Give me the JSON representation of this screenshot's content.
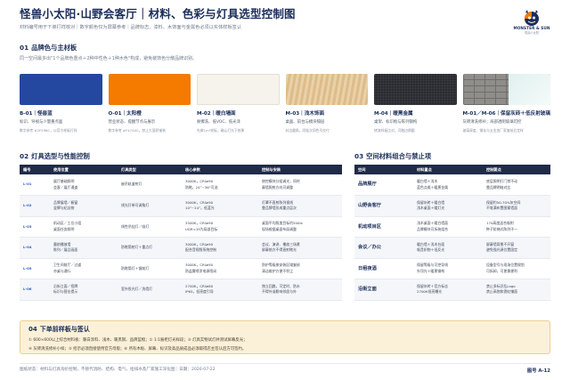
{
  "header": {
    "title": "怪兽小太阳·山野会客厅｜材料、色彩与灯具选型控制图",
    "subtitle": "材料编号用于下单打样核对｜数字颜色仅为屏幕参考｜品牌标志、漆料、木饰面与金属色必须以实体样板签认",
    "logo_text": "MONSTER & SUN",
    "logo_sub": "怪兽小太阳"
  },
  "section1": {
    "number": "01",
    "title": "品牌色与主材板",
    "desc": "同一空间最多出\"1个品牌色重点＋2种中性色＋1种木色\"构成，避免装饰色分散品牌识别。",
    "swatches": [
      {
        "name": "B-01｜怪兽蓝",
        "desc": "标识、导视与少量重点面",
        "spec": "数字参考 #2F59BC，以官方样板打样",
        "color": "#2448a0"
      },
      {
        "name": "O-01｜太阳橙",
        "desc": "营业状态、提醒节点与展示",
        "spec": "数字参考 #F47A00，禁止大面积铺装",
        "color": "#f47a00"
      },
      {
        "name": "M-02｜暖白墙面",
        "desc": "耐擦洗、低VOC、低光泽",
        "spec": "先做1m²样板，确认灯光下效果",
        "color": "#f6f3ec"
      },
      {
        "name": "M-03｜浅木饰面",
        "desc": "桌面、前台与模块隔层",
        "spec": "封边圆角，同批次同色号交付",
        "color": "#e6c796"
      },
      {
        "name": "M-04｜暖黑金属",
        "desc": "桌架、标识框与陈列钢构",
        "spec": "烤漆样板比对，可触边倒圆",
        "color": "#2a2c31"
      },
      {
        "name": "M-01／M-06｜保留灰砖＋低反射玻璃",
        "desc": "灰砖清洗修补；局部透明玻璃可控",
        "spec": "玻璃厚度、钢化与五金由厂家复核后定样",
        "color": "#8f8e8b"
      }
    ]
  },
  "section2": {
    "number": "02",
    "title": "灯具选型与性能控制",
    "headers": [
      "编号",
      "使用位置",
      "灯具类型",
      "核心参数",
      "控制与安装"
    ],
    "rows": [
      {
        "code": "L-01",
        "location": [
          "展厅基础照明",
          "会客／展厅通道"
        ],
        "type": [
          "嵌吊轨道射灯"
        ],
        "params": [
          "3000K，CRI≥90",
          "防眩，24°~36°可选"
        ],
        "control": [
          "统控模块分组调光，同时",
          "幕墙照射方向可调整"
        ]
      },
      {
        "code": "L-02",
        "location": [
          "品牌展墙／橱窗",
          "竖牌与纪念物"
        ],
        "type": [
          "线光灯带可调角灯"
        ],
        "params": [
          "3000K，CRI≥90",
          "10°~24°，低蓝光"
        ],
        "control": [
          "灯罩不直射陈列视线",
          "靠品牌墙形成重点层次"
        ]
      },
      {
        "code": "L-03",
        "location": [
          "机动区／工位小组",
          "桌面任务照明"
        ],
        "type": [
          "线性吊挂灯／吸灯"
        ],
        "params": [
          "3500K，CRI≥90",
          "UGR<19为局部目标"
        ],
        "control": [
          "桌面平均照度目标约500lx",
          "现场根据桌面布局调整"
        ]
      },
      {
        "code": "L-04",
        "location": [
          "墨前播放墙",
          "陈列／展品画面"
        ],
        "type": [
          "防眩筒射灯＋重点灯"
        ],
        "params": [
          "3000K，CRI≥90",
          "配合音视频系统控制"
        ],
        "control": [
          "会议、演讲、播放三场景",
          "屏幕前方不得直射眩光"
        ]
      },
      {
        "code": "L-05",
        "location": [
          "卫生间前厅／过道",
          "亦桌与通行"
        ],
        "type": [
          "防眩筒灯＋镜前灯"
        ],
        "params": [
          "3000K，CRI≥90",
          "防盐雾喷涂电源密闭"
        ],
        "control": [
          "防护等级按安装区域复核",
          "清洁维护方便不积尘"
        ]
      },
      {
        "code": "L-06",
        "location": [
          "沿街立面／招牌",
          "标识与营业提示"
        ],
        "type": [
          "室外投光灯／洗墙灯"
        ],
        "params": [
          "2700K，CRI≥80",
          "IP65，低亮度引导"
        ],
        "control": [
          "独立回路，可定时、防水",
          "不得外溢影响邻居与外"
        ]
      }
    ]
  },
  "section3": {
    "number": "03",
    "title": "空间材料组合与禁止项",
    "headers": [
      "空间",
      "材料重点",
      "控制要点"
    ],
    "rows": [
      {
        "zone": "品牌展厅",
        "material": [
          "暖白墙＋浅木",
          "蓝色点缀＋暖黑金属"
        ],
        "control": [
          "底层照明打门禁不动",
          "靠品牌明暗对比"
        ]
      },
      {
        "zone": "山野会客厅",
        "material": [
          "保留灰砖＋暖白墙",
          "浅木桌面＋暖灯光"
        ],
        "control": [
          "保留约50-70%灰空间",
          "不堆满布置图案墙面"
        ]
      },
      {
        "zone": "机动项目区",
        "material": [
          "浅木桌面＋暖白墙面",
          "品牌模块可拆装组合"
        ],
        "control": [
          "170高度适合吸附",
          "种子阶梯式陈列不一"
        ]
      },
      {
        "zone": "会议／办公",
        "material": [
          "暖白墙＋浅木台面",
          "吸音织物＋低反光"
        ],
        "control": [
          "屏幕墙背景不开窗",
          "避免强光源位置固定"
        ]
      },
      {
        "zone": "日租夜酒",
        "material": [
          "保留等级与可控导线",
          "外顶光＋暖黑钢构"
        ],
        "control": [
          "设备型号与现场位置规划",
          "可拆卸，可更换便利"
        ]
      },
      {
        "zone": "沿街立面",
        "material": [
          "保留灰砖＋官方标志",
          "2700K低亮曝光"
        ],
        "control": [
          "禁止多标识乱Logo",
          "禁止高饱和霓虹铺面"
        ]
      }
    ]
  },
  "section4": {
    "number": "04",
    "title": "下单前样板与签认",
    "line1": "① 600×600以上综合材料板：暖白涂料、浅木、暖黑钢、品牌蓝橙；② 1:1展柜灯光样段；③ 灯具实物试灯并测试屏幕反光；",
    "line2": "④ 灰砖清洗修补小样；⑤ 招示必须直接使用官方母版；⑥ 所有木板、屏幕、标识及高品质成品必须取得店主签认后方可签约。"
  },
  "footer": {
    "left": "图纸状态：材料与灯具询价控制，不替代消防、结构、电气、给排水及厂家施工深化图｜日期：2026-07-22",
    "right": "图号 A-12"
  },
  "colors": {
    "navy": "#1b2d5a",
    "brand_blue": "#2f59bc",
    "brand_orange": "#f47a00"
  }
}
